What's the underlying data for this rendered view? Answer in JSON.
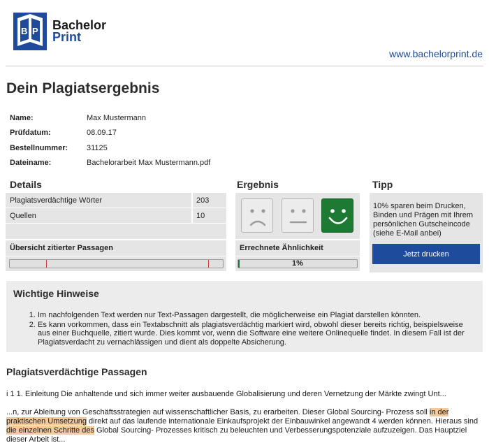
{
  "header": {
    "logo_line1": "Bachelor",
    "logo_line2": "Print",
    "site_url": "www.bachelorprint.de",
    "logo_icon": "book-icon",
    "brand_color": "#1e4b9c"
  },
  "page_title": "Dein Plagiatsergebnis",
  "meta": [
    {
      "label": "Name:",
      "value": "Max Mustermann"
    },
    {
      "label": "Prüfdatum:",
      "value": "08.09.17"
    },
    {
      "label": "Bestellnummer:",
      "value": "31125"
    },
    {
      "label": "Dateiname:",
      "value": "Bachelorarbeit Max Mustermann.pdf"
    }
  ],
  "details": {
    "title": "Details",
    "rows": [
      {
        "label": "Plagiatsverdächtige Wörter",
        "value": "203"
      },
      {
        "label": "Quellen",
        "value": "10"
      }
    ],
    "passages_title": "Übersicht zitierter Passagen",
    "passage_marks": [
      0.17,
      0.93
    ]
  },
  "ergebnis": {
    "title": "Ergebnis",
    "faces": [
      {
        "icon": "sad-face-icon",
        "active": false
      },
      {
        "icon": "neutral-face-icon",
        "active": false
      },
      {
        "icon": "happy-face-icon",
        "active": true
      }
    ],
    "similarity_title": "Errechnete Ähnlichkeit",
    "similarity_value": 1,
    "similarity_label": "1%",
    "accent_color": "#1d7a33"
  },
  "tipp": {
    "title": "Tipp",
    "text": "10% sparen beim Drucken, Binden und Prägen mit Ihrem persönlichen Gutscheincode (siehe E-Mail anbei)",
    "button_label": "Jetzt drucken"
  },
  "hinweise": {
    "title": "Wichtige Hinweise",
    "items": [
      "Im nachfolgenden Text werden nur Text-Passagen dargestellt, die möglicherweise ein Plagiat darstellen könnten.",
      "Es kann vorkommen, dass ein Textabschnitt als plagiatsverdächtig markiert wird, obwohl dieser bereits richtig, beispielsweise aus einer Buchquelle, zitiert wurde. Dies kommt vor, wenn die Software eine weitere Onlinequelle findet. In diesem Fall ist der Plagiatsverdacht zu vernachlässigen und dient als doppelte Absicherung."
    ]
  },
  "passagen": {
    "title": "Plagiatsverdächtige Passagen",
    "para1": "i 1 1. Einleitung Die anhaltende und sich immer weiter ausbauende Globalisierung und deren Vernetzung der Märkte zwingt Unt...",
    "para2_a": "...n, zur Ableitung von Geschäftsstrategien auf wissenschaftlicher Basis, zu erarbeiten. Dieser Global Sourcing- Prozess soll ",
    "para2_hl1": "in der praktischen Umsetzung",
    "para2_b": " direkt auf das laufende internationale Einkaufsprojekt der Einbauwinkel angewandt 4 werden können. Hieraus sind ",
    "para2_hl2": "die einzelnen Schritte des",
    "para2_c": " Global Sourcing- Prozesses kritisch zu beleuchten und Verbesserungspotenziale aufzuzeigen. Das Hauptziel dieser Arbeit ist...",
    "highlight_color": "#f4c99b"
  }
}
